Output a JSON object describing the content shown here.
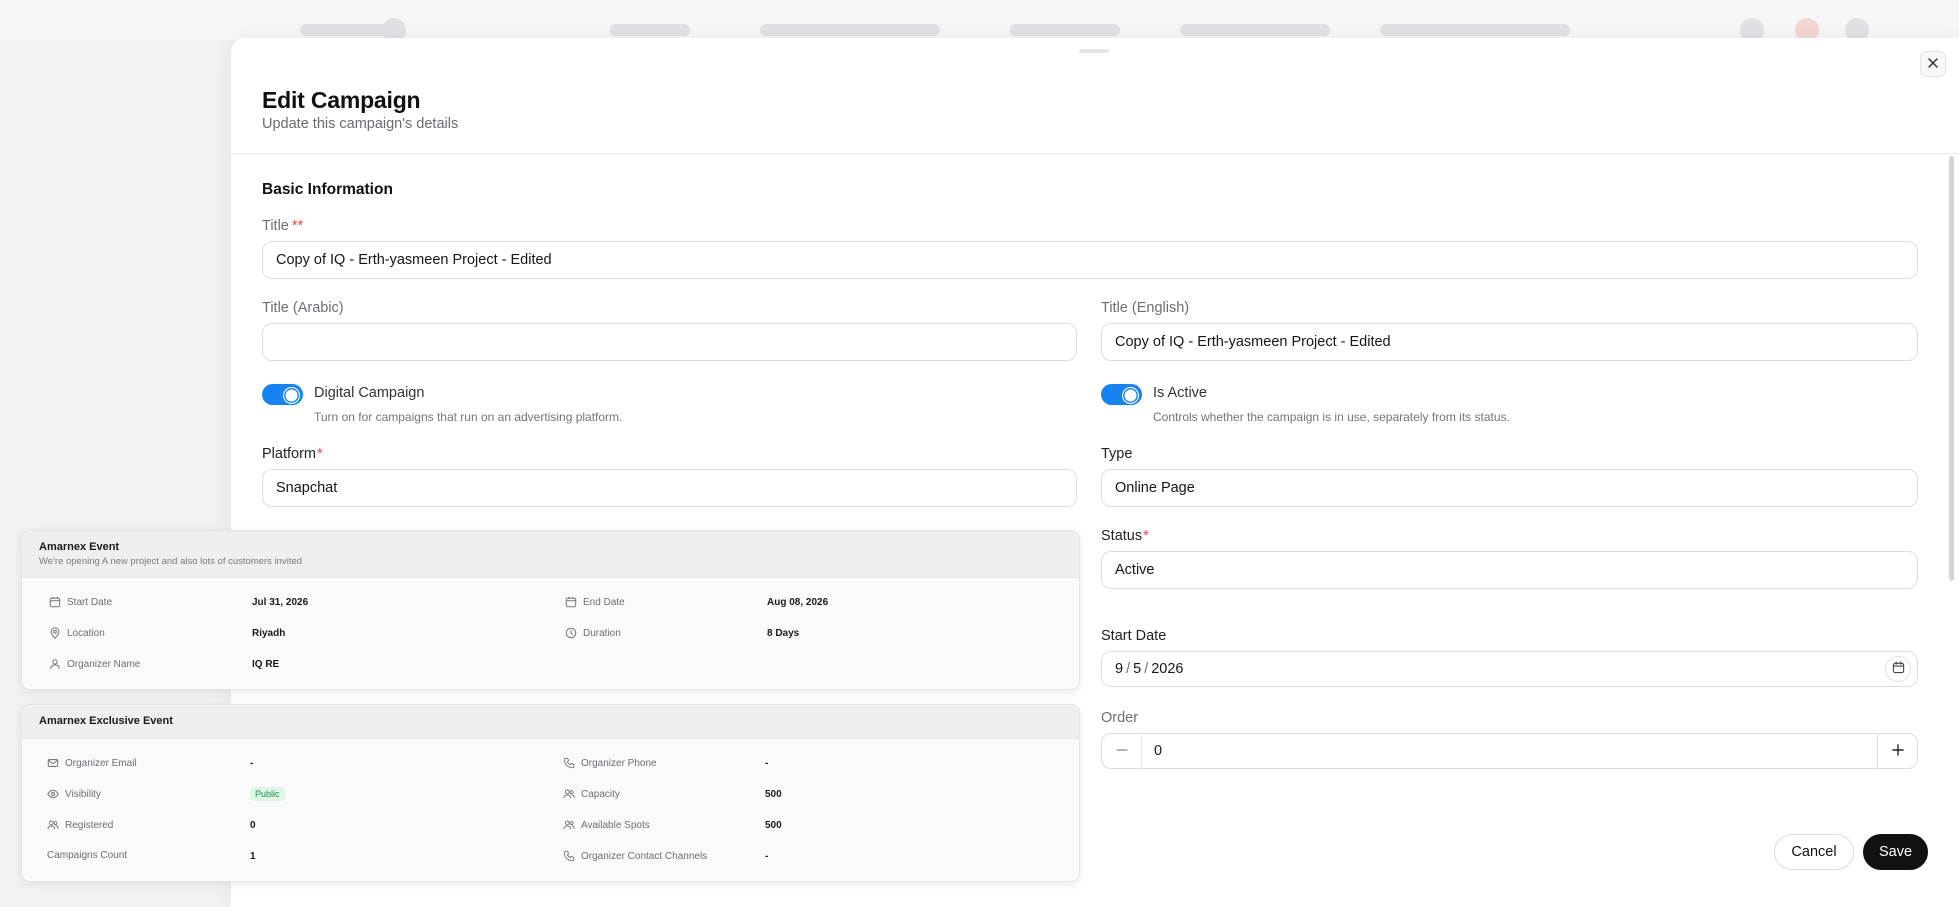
{
  "drawer": {
    "title": "Edit Campaign",
    "subtitle": "Update this campaign's details"
  },
  "form": {
    "section_title": "Basic Information",
    "title_label": "Title",
    "title_required_marks": "**",
    "title_value": "Copy of IQ - Erth-yasmeen Project - Edited",
    "title_arabic_label": "Title (Arabic)",
    "title_arabic_value": "",
    "title_english_label": "Title (English)",
    "title_english_value": "Copy of IQ - Erth-yasmeen Project - Edited",
    "digital_campaign_label": "Digital Campaign",
    "digital_campaign_help": "Turn on for campaigns that run on an advertising platform.",
    "digital_campaign_on": true,
    "is_active_label": "Is Active",
    "is_active_help": "Controls whether the campaign is in use, separately from its status.",
    "is_active_on": true,
    "platform_label": "Platform",
    "platform_value": "Snapchat",
    "type_label": "Type",
    "type_value": "Online Page",
    "status_label": "Status",
    "status_value": "Active",
    "required_mark": "*",
    "start_date_label": "Start Date",
    "start_date_month": "9",
    "start_date_day": "5",
    "start_date_year": "2026",
    "date_sep": "/",
    "order_label": "Order",
    "order_value": "0",
    "cancel_label": "Cancel",
    "save_label": "Save"
  },
  "event_card": {
    "title": "Amarnex Event",
    "subtitle": "We're opening A new project and also lots of customers invited",
    "start_date_key": "Start Date",
    "start_date_value": "Jul 31, 2026",
    "end_date_key": "End Date",
    "end_date_value": "Aug 08, 2026",
    "location_key": "Location",
    "location_value": "Riyadh",
    "duration_key": "Duration",
    "duration_value": "8 Days",
    "organizer_name_key": "Organizer Name",
    "organizer_name_value": "IQ RE"
  },
  "exclusive_card": {
    "title": "Amarnex Exclusive Event",
    "organizer_email_key": "Organizer Email",
    "organizer_email_value": "-",
    "organizer_phone_key": "Organizer Phone",
    "organizer_phone_value": "-",
    "visibility_key": "Visibility",
    "visibility_value": "Public",
    "capacity_key": "Capacity",
    "capacity_value": "500",
    "registered_key": "Registered",
    "registered_value": "0",
    "available_spots_key": "Available Spots",
    "available_spots_value": "500",
    "campaigns_count_key": "Campaigns Count",
    "campaigns_count_value": "1",
    "contact_channels_key": "Organizer Contact Channels",
    "contact_channels_value": "-"
  },
  "colors": {
    "accent": "#1683f0",
    "required": "#e5484d",
    "primary_button": "#111111",
    "badge_bg": "#dff5e7",
    "badge_text": "#1e8f4f"
  },
  "icons": [
    "close-icon",
    "calendar-icon",
    "minus-icon",
    "plus-icon",
    "map-pin-icon",
    "clock-icon",
    "user-icon",
    "mail-icon",
    "phone-icon",
    "eye-icon",
    "users-icon"
  ]
}
